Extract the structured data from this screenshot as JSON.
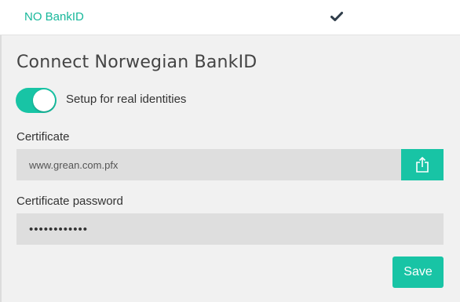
{
  "provider_row": {
    "name": "NO BankID",
    "selected_icon": "checkmark-icon",
    "accent_color": "#18b89b"
  },
  "panel": {
    "title": "Connect Norwegian BankID",
    "toggle": {
      "label": "Setup for real identities",
      "on": true,
      "color": "#18c4a5"
    },
    "certificate": {
      "label": "Certificate",
      "value": "www.grean.com.pfx",
      "upload_icon": "upload-icon"
    },
    "password": {
      "label": "Certificate password",
      "value": "••••••••••••"
    },
    "save_label": "Save"
  }
}
